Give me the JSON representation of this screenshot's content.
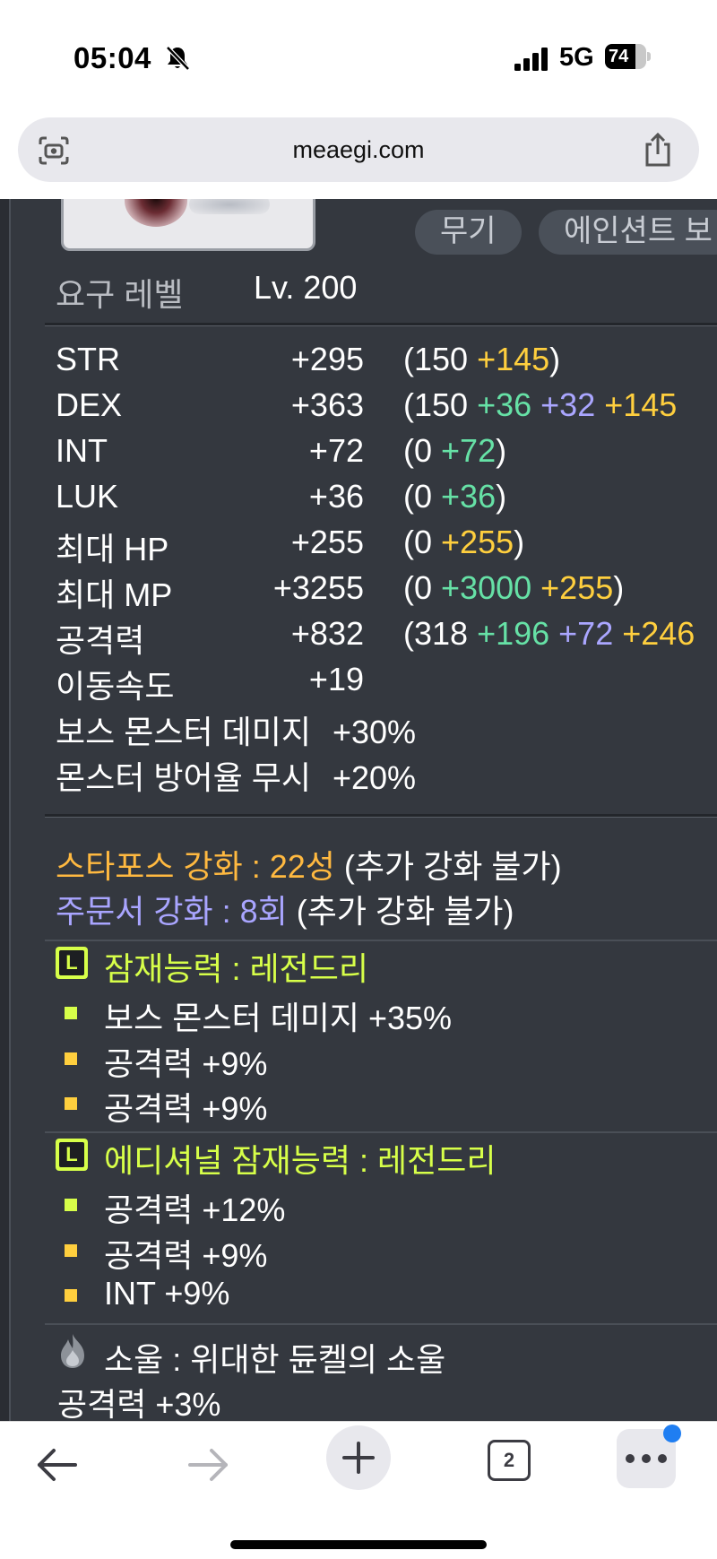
{
  "status_bar": {
    "time": "05:04",
    "network": "5G",
    "battery": "74",
    "battery_level": 0.74
  },
  "browser": {
    "url": "meaegi.com",
    "tab_count": "2"
  },
  "item": {
    "tags": [
      "무기",
      "에인션트 보"
    ],
    "required_level_label": "요구 레벨",
    "required_level_value": "Lv. 200",
    "stats": [
      {
        "name": "STR",
        "total": "+295",
        "parts": [
          [
            "(150",
            "base"
          ],
          [
            " +145",
            "yellow"
          ],
          [
            ")",
            "base"
          ]
        ]
      },
      {
        "name": "DEX",
        "total": "+363",
        "parts": [
          [
            "(150",
            "base"
          ],
          [
            " +36",
            "green"
          ],
          [
            " +32",
            "purple"
          ],
          [
            " +145",
            "yellow"
          ]
        ]
      },
      {
        "name": "INT",
        "total": "+72",
        "parts": [
          [
            "(0",
            "base"
          ],
          [
            " +72",
            "green"
          ],
          [
            ")",
            "base"
          ]
        ]
      },
      {
        "name": "LUK",
        "total": "+36",
        "parts": [
          [
            "(0",
            "base"
          ],
          [
            " +36",
            "green"
          ],
          [
            ")",
            "base"
          ]
        ]
      },
      {
        "name": "최대 HP",
        "total": "+255",
        "parts": [
          [
            "(0",
            "base"
          ],
          [
            " +255",
            "yellow"
          ],
          [
            ")",
            "base"
          ]
        ]
      },
      {
        "name": "최대 MP",
        "total": "+3255",
        "parts": [
          [
            "(0",
            "base"
          ],
          [
            " +3000",
            "green"
          ],
          [
            " +255",
            "yellow"
          ],
          [
            ")",
            "base"
          ]
        ]
      },
      {
        "name": "공격력",
        "total": "+832",
        "parts": [
          [
            "(318",
            "base"
          ],
          [
            " +196",
            "green"
          ],
          [
            " +72",
            "purple"
          ],
          [
            " +246",
            "yellow"
          ]
        ]
      },
      {
        "name": "이동속도",
        "total": "+19",
        "parts": []
      }
    ],
    "special_stats": [
      {
        "name": "보스 몬스터 데미지",
        "value": "+30%"
      },
      {
        "name": "몬스터 방어율 무시",
        "value": "+20%"
      }
    ],
    "starforce_label": "스타포스 강화 : 22성",
    "starforce_note": " (추가 강화 불가)",
    "scroll_label": "주문서 강화 : 8회",
    "scroll_note": " (추가 강화 불가)",
    "potential": {
      "badge": "L",
      "title": "잠재능력 : 레전드리",
      "lines": [
        {
          "text": "보스 몬스터 데미지 +35%",
          "tier": "lg"
        },
        {
          "text": "공격력 +9%",
          "tier": "un"
        },
        {
          "text": "공격력 +9%",
          "tier": "un"
        }
      ]
    },
    "additional_potential": {
      "badge": "L",
      "title": "에디셔널 잠재능력 : 레전드리",
      "lines": [
        {
          "text": "공격력 +12%",
          "tier": "lg"
        },
        {
          "text": "공격력 +9%",
          "tier": "un"
        },
        {
          "text": "INT +9%",
          "tier": "un"
        }
      ]
    },
    "soul": {
      "title": "소울 : 위대한 듄켈의 소울",
      "effect": "공격력 +3%"
    }
  },
  "colors": {
    "panel_bg": "#34383f",
    "green": "#66e1a6",
    "purple": "#aaa6ff",
    "yellow": "#ffcf3e",
    "orange": "#ffb940",
    "legendary": "#d7ff49"
  },
  "icons": [
    "bell-slash-icon",
    "signal-icon",
    "battery-icon",
    "camera-scan-icon",
    "share-icon",
    "back-arrow-icon",
    "forward-arrow-icon",
    "plus-icon",
    "tabs-icon",
    "more-dots-icon",
    "flame-icon"
  ]
}
